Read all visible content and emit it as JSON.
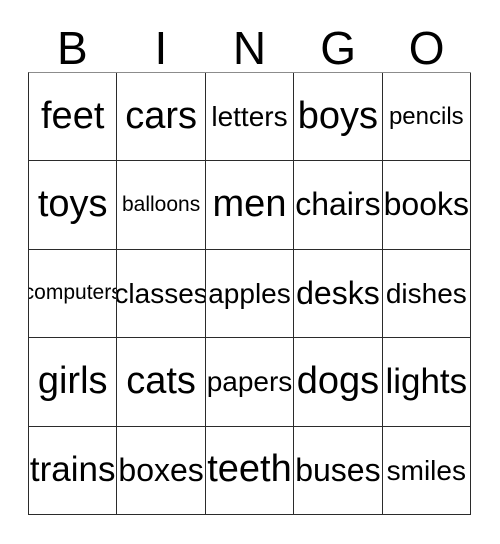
{
  "card": {
    "headers": [
      "B",
      "I",
      "N",
      "G",
      "O"
    ],
    "colors": {
      "background": "#ffffff",
      "text": "#000000",
      "grid_line": "#2b2b2b"
    },
    "rows": [
      [
        {
          "text": "feet",
          "size": "xxl"
        },
        {
          "text": "cars",
          "size": "xxl"
        },
        {
          "text": "letters",
          "size": "m"
        },
        {
          "text": "boys",
          "size": "xxl"
        },
        {
          "text": "pencils",
          "size": "s"
        }
      ],
      [
        {
          "text": "toys",
          "size": "xxl"
        },
        {
          "text": "balloons",
          "size": "xs"
        },
        {
          "text": "men",
          "size": "xxl"
        },
        {
          "text": "chairs",
          "size": "l"
        },
        {
          "text": "books",
          "size": "l"
        }
      ],
      [
        {
          "text": "computers",
          "size": "xs"
        },
        {
          "text": "classes",
          "size": "m"
        },
        {
          "text": "apples",
          "size": "m"
        },
        {
          "text": "desks",
          "size": "l"
        },
        {
          "text": "dishes",
          "size": "m"
        }
      ],
      [
        {
          "text": "girls",
          "size": "xxl"
        },
        {
          "text": "cats",
          "size": "xxl"
        },
        {
          "text": "papers",
          "size": "m"
        },
        {
          "text": "dogs",
          "size": "xxl"
        },
        {
          "text": "lights",
          "size": "xl"
        }
      ],
      [
        {
          "text": "trains",
          "size": "xl"
        },
        {
          "text": "boxes",
          "size": "l"
        },
        {
          "text": "teeth",
          "size": "xxl"
        },
        {
          "text": "buses",
          "size": "l"
        },
        {
          "text": "smiles",
          "size": "m"
        }
      ]
    ]
  }
}
